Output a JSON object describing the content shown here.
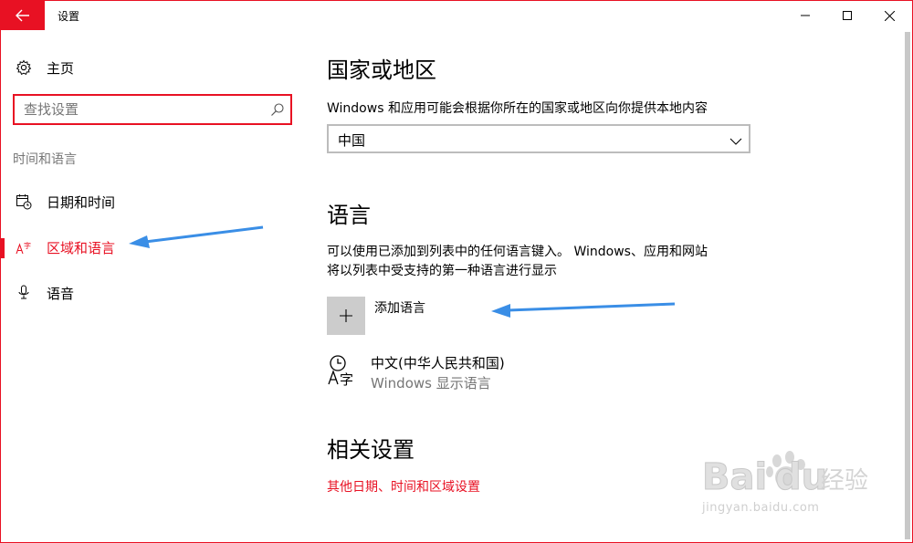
{
  "window": {
    "title": "设置"
  },
  "sidebar": {
    "home_label": "主页",
    "search_placeholder": "查找设置",
    "section_label": "时间和语言",
    "items": [
      {
        "label": "日期和时间",
        "icon": "calendar-clock-icon",
        "active": false
      },
      {
        "label": "区域和语言",
        "icon": "language-icon",
        "active": true
      },
      {
        "label": "语音",
        "icon": "microphone-icon",
        "active": false
      }
    ]
  },
  "main": {
    "region_title": "国家或地区",
    "region_desc": "Windows 和应用可能会根据你所在的国家或地区向你提供本地内容",
    "region_value": "中国",
    "language_title": "语言",
    "language_desc_line1": "可以使用已添加到列表中的任何语言键入。 Windows、应用和网站",
    "language_desc_line2": "将以列表中受支持的第一种语言进行显示",
    "add_language_label": "添加语言",
    "language_entry": {
      "name": "中文(中华人民共和国)",
      "sub": "Windows 显示语言"
    },
    "related_title": "相关设置",
    "related_link": "其他日期、时间和区域设置"
  },
  "watermark": {
    "text": "jingyan.baidu.com"
  },
  "colors": {
    "accent": "#e81123",
    "annotation_arrow": "#3a8ee6",
    "secondary_text": "#767676"
  }
}
